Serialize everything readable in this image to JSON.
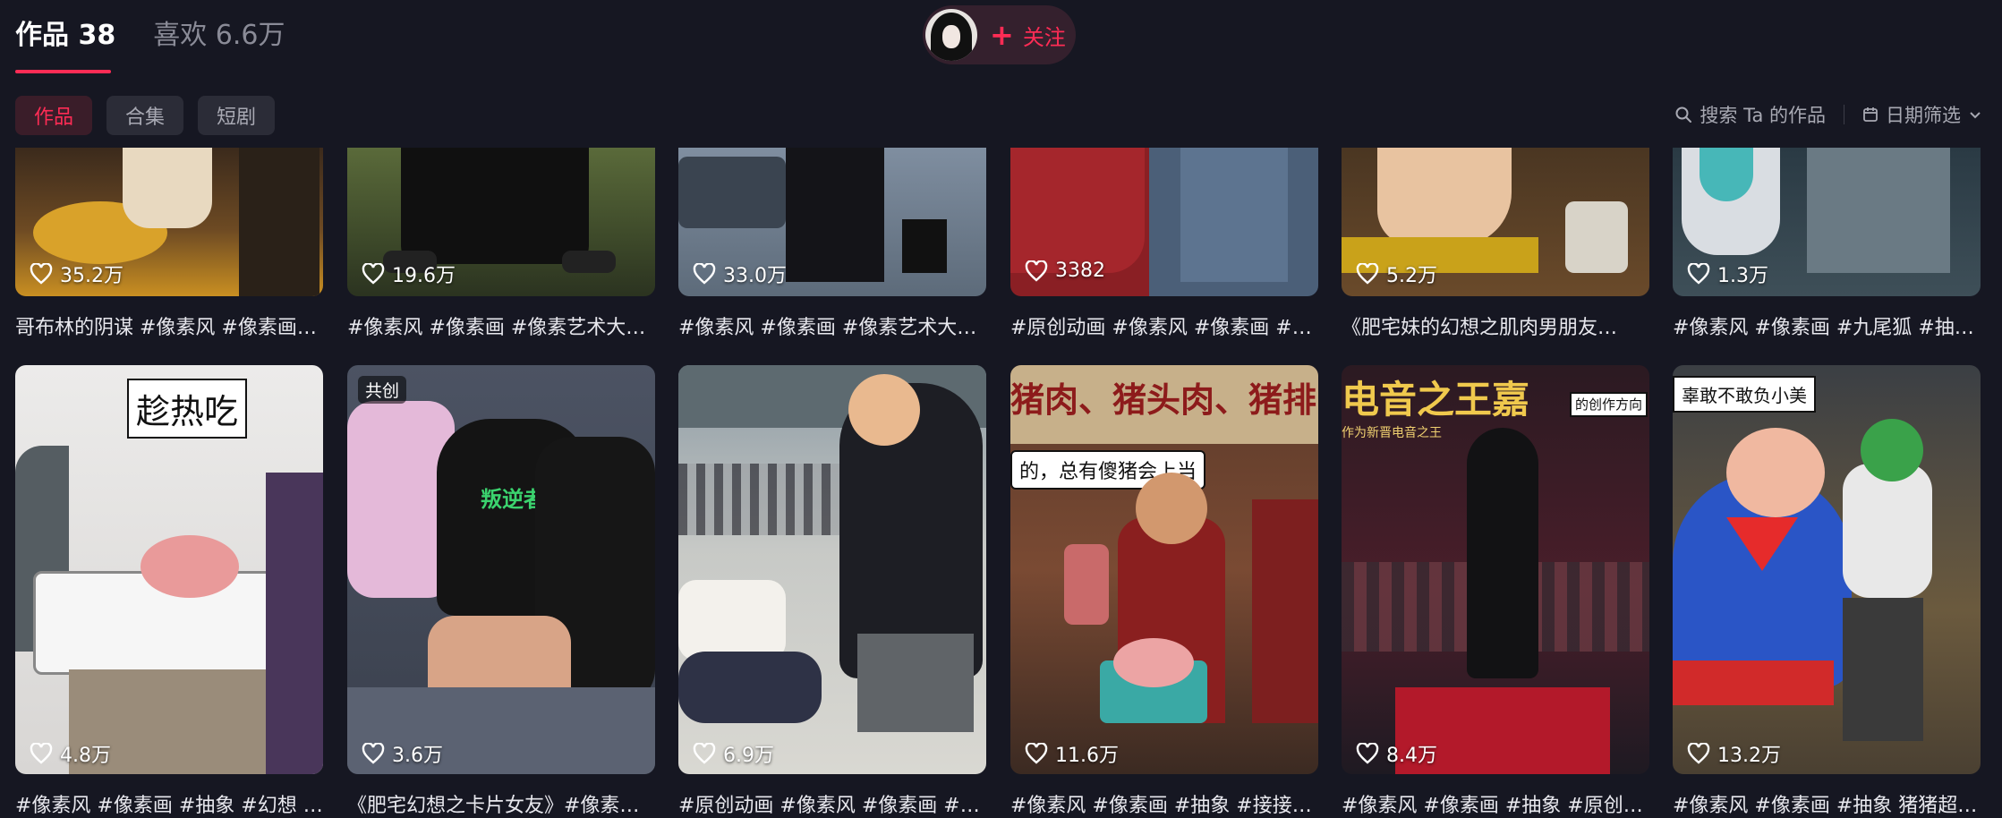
{
  "tabs": [
    {
      "label": "作品 38",
      "active": true
    },
    {
      "label": "喜欢 6.6万",
      "active": false
    }
  ],
  "follow": {
    "label": "关注",
    "plus": "+"
  },
  "subtabs": [
    {
      "label": "作品",
      "active": true
    },
    {
      "label": "合集",
      "active": false
    },
    {
      "label": "短剧",
      "active": false
    }
  ],
  "tools": {
    "search": "搜索 Ta 的作品",
    "date_filter": "日期筛选"
  },
  "colors": {
    "accent": "#fe2c55",
    "background": "#161722"
  },
  "icons": {
    "like": "heart-outline-icon",
    "search": "search-icon",
    "calendar": "calendar-icon",
    "chevron": "chevron-down-icon"
  },
  "row1": [
    {
      "likes": "35.2万",
      "caption": "哥布林的阴谋 #像素风 #像素画…"
    },
    {
      "likes": "19.6万",
      "caption": "#像素风 #像素画 #像素艺术大…"
    },
    {
      "likes": "33.0万",
      "caption": "#像素风 #像素画 #像素艺术大…"
    },
    {
      "likes": "3382",
      "caption": "#原创动画 #像素风 #像素画 #…"
    },
    {
      "likes": "5.2万",
      "caption": "《肥宅妹的幻想之肌肉男朋友…"
    },
    {
      "likes": "1.3万",
      "caption": "#像素风 #像素画 #九尾狐 #抽…"
    }
  ],
  "row2": [
    {
      "likes": "4.8万",
      "caption": "#像素风 #像素画 #抽象 #幻想 …",
      "art_text": "趁热吃"
    },
    {
      "likes": "3.6万",
      "caption": "《肥宅幻想之卡片女友》#像素…",
      "badge": "共创",
      "art_text": "叛逆者"
    },
    {
      "likes": "6.9万",
      "caption": "#原创动画 #像素风 #像素画 #…"
    },
    {
      "likes": "11.6万",
      "caption": "#像素风 #像素画 #抽象 #接接…",
      "art_text": "猪肉、猪头肉、猪排",
      "art_text2": "的，总有傻猪会上当"
    },
    {
      "likes": "8.4万",
      "caption": "#像素风 #像素画 #抽象 #原创…",
      "art_text": "电音之王嘉",
      "art_text2": "作为新晋电音之王",
      "art_text3": "的创作方向"
    },
    {
      "likes": "13.2万",
      "caption": "#像素风 #像素画 #抽象 猪猪超…",
      "art_text": "辜敢不敢负小美"
    }
  ]
}
